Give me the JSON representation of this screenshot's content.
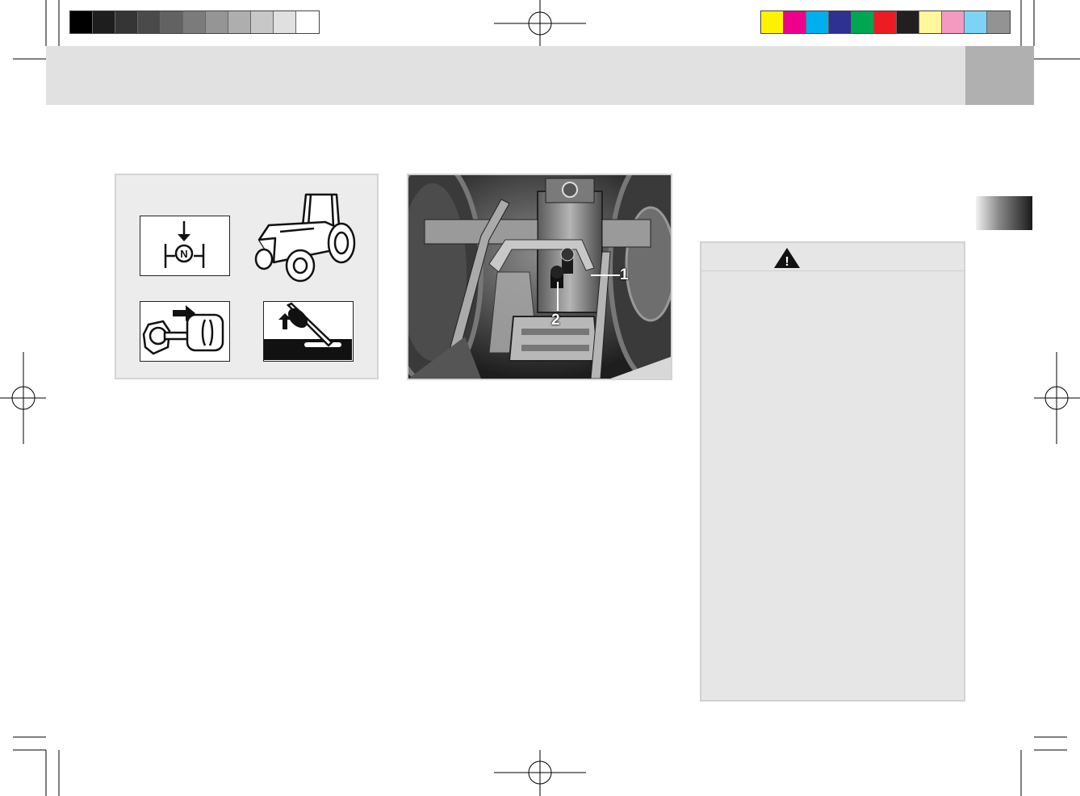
{
  "print_marks": {
    "grayscale_bar": [
      "#000000",
      "#1e1e1e",
      "#353535",
      "#4a4a4a",
      "#626262",
      "#7b7b7b",
      "#959595",
      "#aeaeae",
      "#c7c7c7",
      "#e0e0e0",
      "#ffffff"
    ],
    "color_bar": [
      "#fff200",
      "#ec008c",
      "#00aeef",
      "#2e3192",
      "#00a651",
      "#ed1c24",
      "#231f20",
      "#fff799",
      "#f49ac1",
      "#7dd3f7",
      "#939393"
    ]
  },
  "colors": {
    "header_band": "#e1e1e1",
    "header_tab": "#b0b0b0",
    "warning_panel": "#e6e6e6"
  },
  "figure_left": {
    "icons": [
      "neutral-position-icon",
      "tractor-icon",
      "remove-key-icon",
      "apply-parking-brake-icon"
    ],
    "neutral_letter": "N"
  },
  "figure_right": {
    "callouts": [
      "1",
      "2"
    ]
  },
  "warning_panel": {
    "icon": "warning-triangle-icon",
    "icon_glyph": "!"
  }
}
